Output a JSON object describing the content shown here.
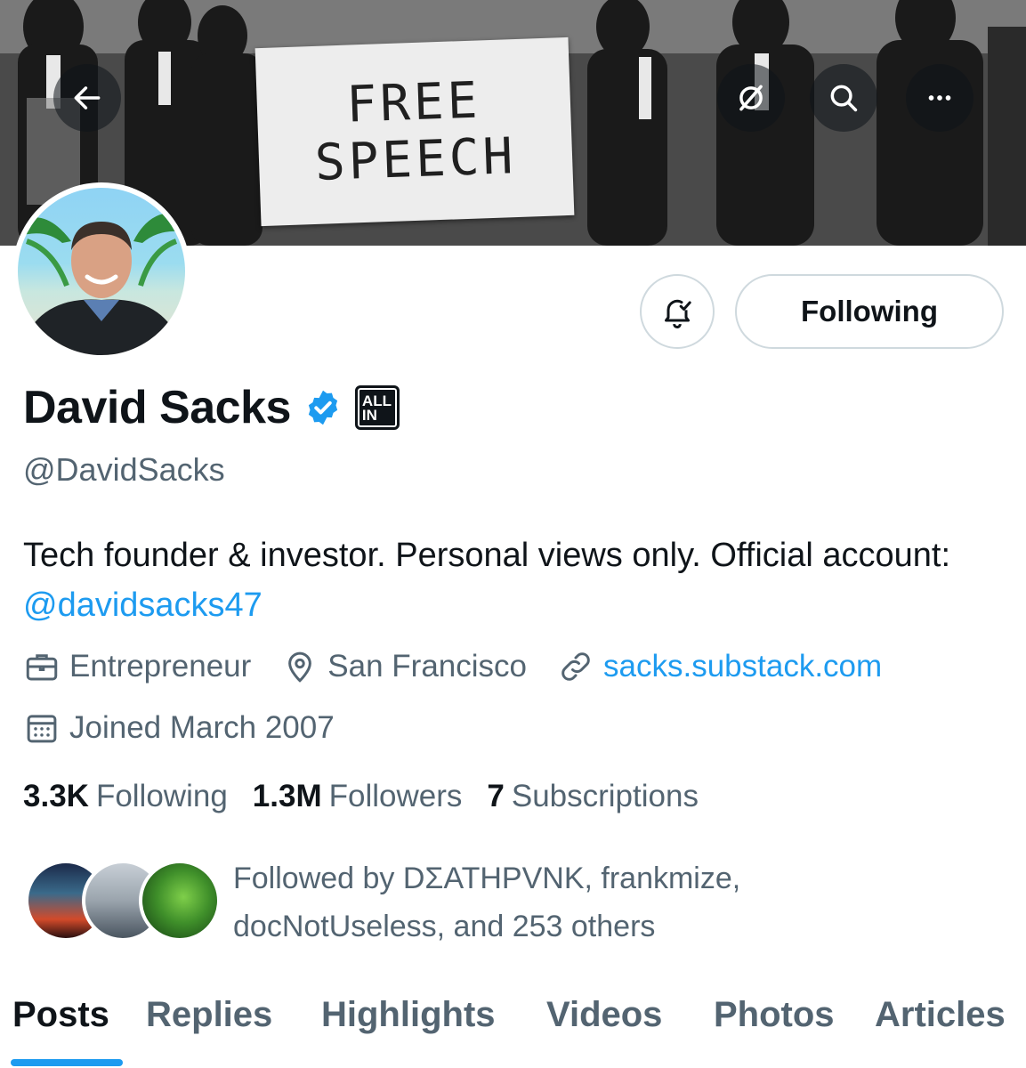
{
  "header": {
    "back_icon": "arrow-left-icon",
    "grok_icon": "grok-icon",
    "search_icon": "search-icon",
    "more_icon": "more-horizontal-icon"
  },
  "banner": {
    "sign_line1": "FREE",
    "sign_line2": "SPEECH"
  },
  "actions": {
    "notification_icon": "bell-check-icon",
    "following_label": "Following"
  },
  "profile": {
    "name": "David Sacks",
    "affiliate_badge": "ALL IN",
    "affiliate_line1": "ALL",
    "affiliate_line2": "IN",
    "handle": "@DavidSacks",
    "bio_text": "Tech founder & investor. Personal views only. Official account: ",
    "bio_mention": "@davidsacks47",
    "profession": "Entrepreneur",
    "location": "San Francisco",
    "website": "sacks.substack.com",
    "joined": "Joined March 2007"
  },
  "stats": {
    "following_count": "3.3K",
    "following_label": "Following",
    "followers_count": "1.3M",
    "followers_label": "Followers",
    "subscriptions_count": "7",
    "subscriptions_label": "Subscriptions"
  },
  "followed_by": {
    "line1": "Followed by DΣATHPVNK, frankmize,",
    "line2": "docNotUseless, and 253 others"
  },
  "tabs": [
    {
      "label": "Posts",
      "active": true
    },
    {
      "label": "Replies",
      "active": false
    },
    {
      "label": "Highlights",
      "active": false
    },
    {
      "label": "Videos",
      "active": false
    },
    {
      "label": "Photos",
      "active": false
    },
    {
      "label": "Articles",
      "active": false
    }
  ],
  "colors": {
    "accent": "#1d9bf0",
    "text_primary": "#0f1419",
    "text_secondary": "#536471",
    "border": "#cfd9de"
  }
}
